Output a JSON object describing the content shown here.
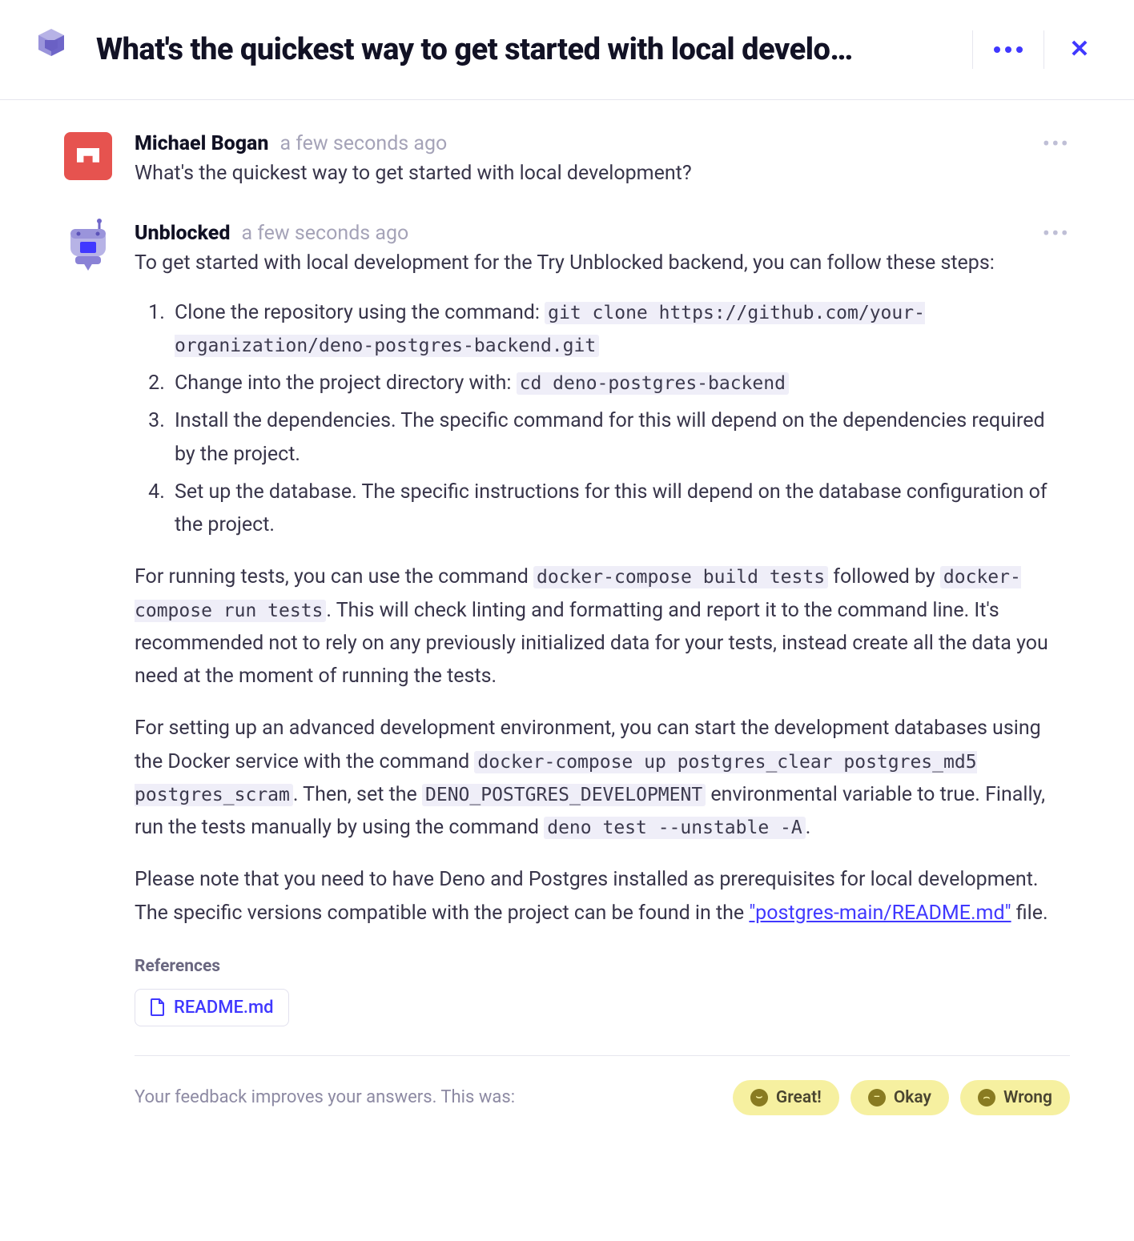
{
  "header": {
    "title": "What's the quickest way to get started with local develo…"
  },
  "messages": {
    "user": {
      "author": "Michael Bogan",
      "time": "a few seconds ago",
      "text": "What's the quickest way to get started with local development?"
    },
    "bot": {
      "author": "Unblocked",
      "time": "a few seconds ago",
      "intro": "To get started with local development for the Try Unblocked backend, you can follow these steps:",
      "steps": {
        "s1_pre": "Clone the repository using the command: ",
        "s1_code": "git clone https://github.com/your-organization/deno-postgres-backend.git",
        "s2_pre": "Change into the project directory with: ",
        "s2_code": "cd deno-postgres-backend",
        "s3": "Install the dependencies. The specific command for this will depend on the dependencies required by the project.",
        "s4": "Set up the database. The specific instructions for this will depend on the database configuration of the project."
      },
      "para_tests": {
        "t1": "For running tests, you can use the command ",
        "c1": "docker-compose build tests",
        "t2": " followed by ",
        "c2": "docker-compose run tests",
        "t3": ". This will check linting and formatting and report it to the command line. It's recommended not to rely on any previously initialized data for your tests, instead create all the data you need at the moment of running the tests."
      },
      "para_adv": {
        "t1": "For setting up an advanced development environment, you can start the development databases using the Docker service with the command ",
        "c1": "docker-compose up postgres_clear postgres_md5 postgres_scram",
        "t2": ". Then, set the ",
        "c2": "DENO_POSTGRES_DEVELOPMENT",
        "t3": " environmental variable to true. Finally, run the tests manually by using the command ",
        "c3": "deno test --unstable -A",
        "t4": "."
      },
      "para_note": {
        "t1": "Please note that you need to have Deno and Postgres installed as prerequisites for local development. The specific versions compatible with the project can be found in the ",
        "link": "\"postgres-main/README.md\"",
        "t2": " file."
      }
    }
  },
  "references": {
    "heading": "References",
    "items": {
      "r1": "README.md"
    }
  },
  "feedback": {
    "prompt": "Your feedback improves your answers. This was:",
    "great": "Great!",
    "okay": "Okay",
    "wrong": "Wrong"
  }
}
